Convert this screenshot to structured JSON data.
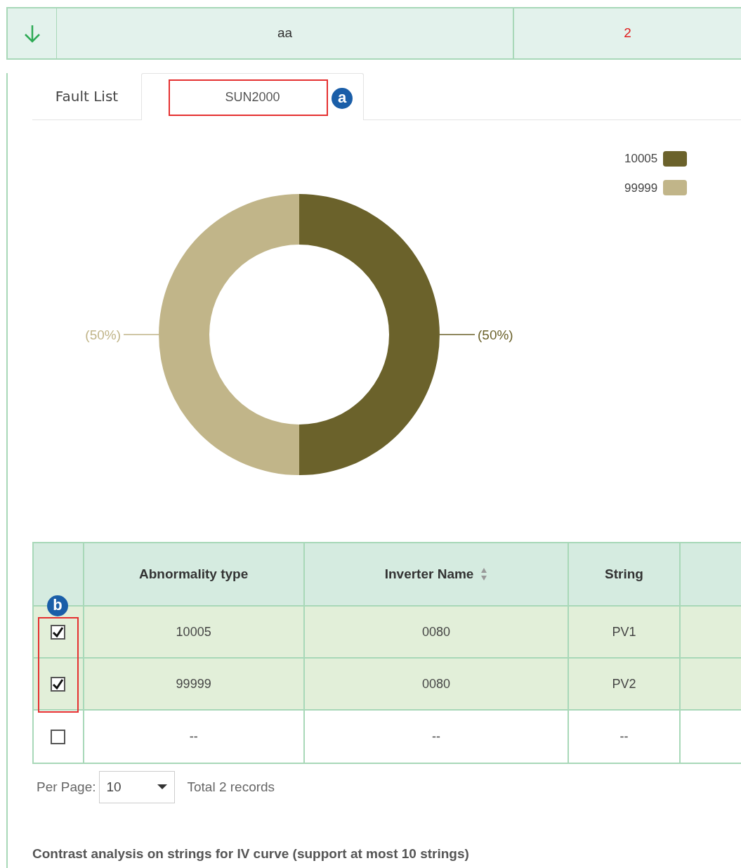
{
  "top_row": {
    "cells": [
      "aa",
      "2"
    ]
  },
  "tabs": [
    {
      "label": "Fault List",
      "selected": false
    },
    {
      "label": "SUN2000",
      "selected": true,
      "callout": "a"
    }
  ],
  "chart_data": {
    "type": "donut",
    "categories": [
      "10005",
      "99999"
    ],
    "values": [
      50,
      50
    ],
    "colors": [
      "#6b622b",
      "#c1b589"
    ],
    "value_labels": [
      "(50%)",
      "(50%)"
    ],
    "legend": "top-right"
  },
  "table": {
    "columns": [
      {
        "label": "Abnormality type",
        "sortable": false
      },
      {
        "label": "Inverter Name",
        "sortable": true
      },
      {
        "label": "String",
        "sortable": false
      }
    ],
    "callout": "b",
    "rows": [
      {
        "checked": true,
        "cells": [
          "10005",
          "0080",
          "PV1"
        ]
      },
      {
        "checked": true,
        "cells": [
          "99999",
          "0080",
          "PV2"
        ]
      },
      {
        "checked": false,
        "cells": [
          "--",
          "--",
          "--"
        ]
      }
    ]
  },
  "pager": {
    "label": "Per Page:",
    "per_page": "10",
    "total": "Total 2 records"
  },
  "section_title": "Contrast analysis on strings for IV curve (support at most 10 strings)"
}
